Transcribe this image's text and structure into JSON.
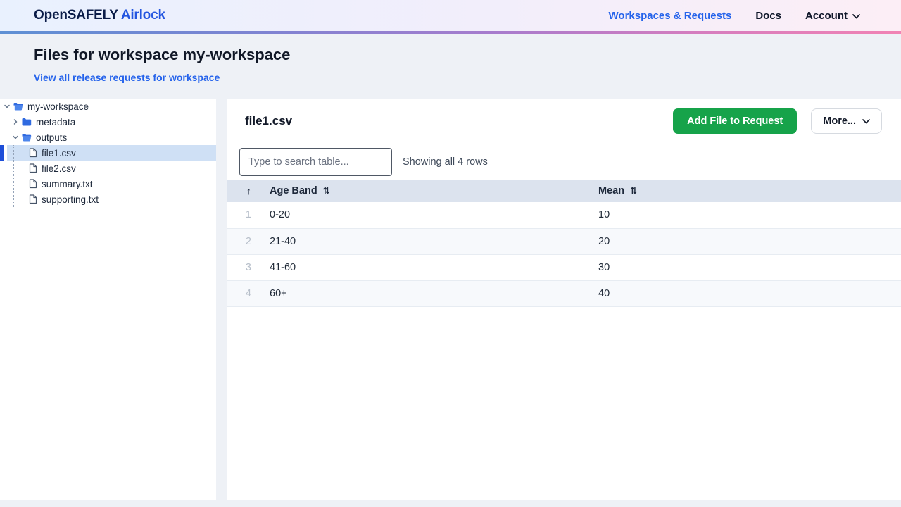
{
  "navbar": {
    "brand_primary": "OpenSAFELY",
    "brand_secondary": "Airlock",
    "links": {
      "workspaces": "Workspaces & Requests",
      "docs": "Docs",
      "account": "Account"
    }
  },
  "header": {
    "title": "Files for workspace my-workspace",
    "link": "View all release requests for workspace"
  },
  "sidebar": {
    "tree": [
      {
        "label": "my-workspace",
        "type": "folder-open",
        "level": 0,
        "expanded": true,
        "selected": false
      },
      {
        "label": "metadata",
        "type": "folder-closed",
        "level": 1,
        "expanded": false,
        "selected": false
      },
      {
        "label": "outputs",
        "type": "folder-open",
        "level": 1,
        "expanded": true,
        "selected": false
      },
      {
        "label": "file1.csv",
        "type": "file",
        "level": 2,
        "selected": true
      },
      {
        "label": "file2.csv",
        "type": "file",
        "level": 2,
        "selected": false
      },
      {
        "label": "summary.txt",
        "type": "file",
        "level": 2,
        "selected": false
      },
      {
        "label": "supporting.txt",
        "type": "file",
        "level": 2,
        "selected": false
      }
    ]
  },
  "main": {
    "file_title": "file1.csv",
    "add_file_button": "Add File to Request",
    "more_button": "More...",
    "search_placeholder": "Type to search table...",
    "rows_status": "Showing all 4 rows"
  },
  "table": {
    "columns": [
      "Age Band",
      "Mean"
    ],
    "rows": [
      {
        "num": "1",
        "age_band": "0-20",
        "mean": "10"
      },
      {
        "num": "2",
        "age_band": "21-40",
        "mean": "20"
      },
      {
        "num": "3",
        "age_band": "41-60",
        "mean": "30"
      },
      {
        "num": "4",
        "age_band": "60+",
        "mean": "40"
      }
    ]
  },
  "colors": {
    "brand_navy": "#0b1c48",
    "accent_blue": "#2563eb",
    "button_green": "#16a34a",
    "selected_row_bg": "#cfe0f5",
    "selected_indicator": "#1d4ed8",
    "table_header_bg": "#dce3ee",
    "nav_gradient_left": "#5e90d4",
    "nav_gradient_right": "#f183b4",
    "page_bg": "#eef1f6"
  }
}
